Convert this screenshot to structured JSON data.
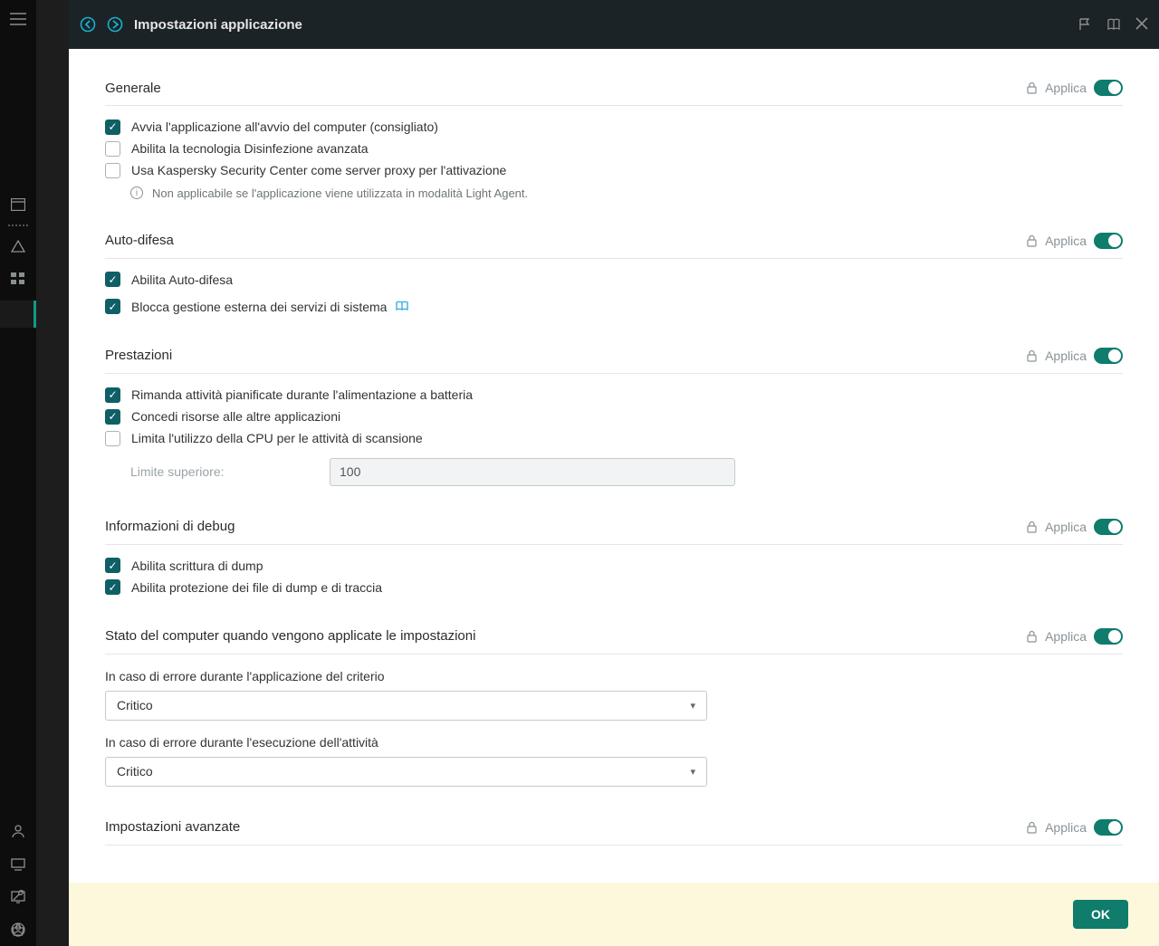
{
  "header": {
    "title": "Impostazioni applicazione"
  },
  "apply_label": "Applica",
  "sections": {
    "general": {
      "title": "Generale",
      "items": [
        "Avvia l'applicazione all'avvio del computer (consigliato)",
        "Abilita la tecnologia Disinfezione avanzata",
        "Usa Kaspersky Security Center come server proxy per l'attivazione"
      ],
      "info": "Non applicabile se l'applicazione viene utilizzata in modalità Light Agent."
    },
    "selfdef": {
      "title": "Auto-difesa",
      "items": [
        "Abilita Auto-difesa",
        "Blocca gestione esterna dei servizi di sistema"
      ]
    },
    "perf": {
      "title": "Prestazioni",
      "items": [
        "Rimanda attività pianificate durante l'alimentazione a batteria",
        "Concedi risorse alle altre applicazioni",
        "Limita l'utilizzo della CPU per le attività di scansione"
      ],
      "limit_label": "Limite superiore:",
      "limit_value": "100"
    },
    "debug": {
      "title": "Informazioni di debug",
      "items": [
        "Abilita scrittura di dump",
        "Abilita protezione dei file di dump e di traccia"
      ]
    },
    "state": {
      "title": "Stato del computer quando vengono applicate le impostazioni",
      "dd1_label": "In caso di errore durante l'applicazione del criterio",
      "dd1_value": "Critico",
      "dd2_label": "In caso di errore durante l'esecuzione dell'attività",
      "dd2_value": "Critico"
    },
    "advanced": {
      "title": "Impostazioni avanzate"
    }
  },
  "footer": {
    "ok": "OK"
  }
}
